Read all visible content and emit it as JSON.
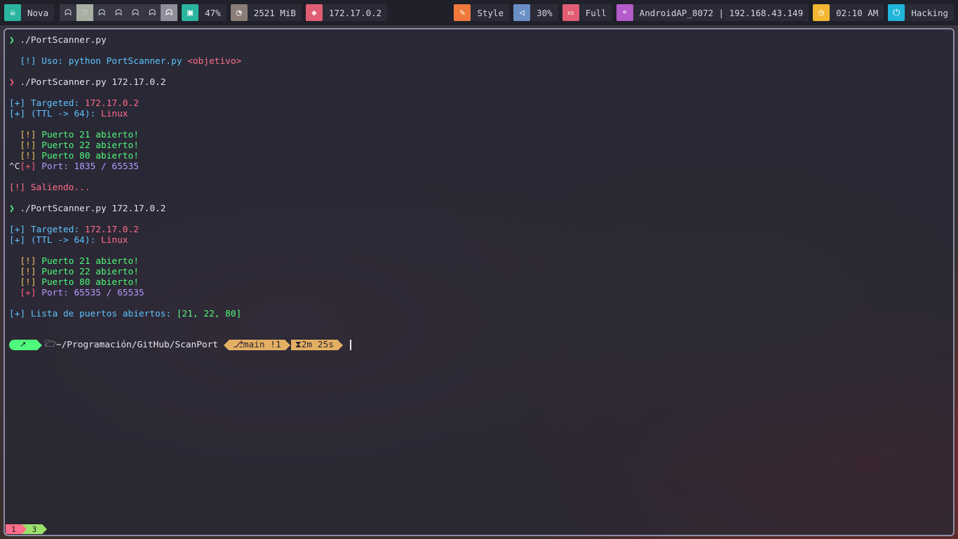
{
  "topbar": {
    "launcher": {
      "icon": "skull-icon",
      "label": "Nova",
      "color": "#2ab5a0"
    },
    "workspaces": [
      "ghost",
      "heart",
      "ghost",
      "ghost",
      "ghost",
      "ghost",
      "ghost"
    ],
    "cpu": {
      "icon": "cpu-icon",
      "value": "47%",
      "color": "#2ab5a0"
    },
    "memory": {
      "icon": "memory-icon",
      "value": "2521 MiB",
      "color": "#8a7d76"
    },
    "ip": {
      "icon": "tag-icon",
      "value": "172.17.0.2",
      "color": "#e05d73"
    },
    "style": {
      "icon": "brush-icon",
      "label": "Style",
      "color": "#ef7a3c"
    },
    "volume": {
      "icon": "speaker-icon",
      "value": "30%",
      "color": "#6a8fc4"
    },
    "battery": {
      "icon": "battery-icon",
      "value": "Full",
      "color": "#e05d73"
    },
    "network": {
      "icon": "wifi-icon",
      "value": "AndroidAP_8072 | 192.168.43.149",
      "color": "#b45cc9"
    },
    "clock": {
      "icon": "clock-icon",
      "value": "02:10 AM",
      "color": "#f2b632"
    },
    "power": {
      "icon": "power-icon",
      "label": "Hacking",
      "color": "#1fb6d9"
    }
  },
  "terminal": {
    "lines": [
      [
        {
          "t": "❯ ",
          "c": "green"
        },
        {
          "t": "./PortScanner.py",
          "c": "white"
        }
      ],
      [],
      [
        {
          "t": "  [!] Uso: ",
          "c": "cyan"
        },
        {
          "t": "python PortScanner.py ",
          "c": "cyan"
        },
        {
          "t": "<objetivo>",
          "c": "pink"
        }
      ],
      [],
      [
        {
          "t": "❯ ",
          "c": "red"
        },
        {
          "t": "./PortScanner.py 172.17.0.2",
          "c": "white"
        }
      ],
      [],
      [
        {
          "t": "[+] Targeted: ",
          "c": "cyan"
        },
        {
          "t": "172.17.0.2",
          "c": "pink"
        }
      ],
      [
        {
          "t": "[+] (TTL -> 64): ",
          "c": "cyan"
        },
        {
          "t": "Linux",
          "c": "pink"
        }
      ],
      [],
      [
        {
          "t": "  [!] ",
          "c": "yellow"
        },
        {
          "t": "Puerto 21 abierto!",
          "c": "green"
        }
      ],
      [
        {
          "t": "  [!] ",
          "c": "yellow"
        },
        {
          "t": "Puerto 22 abierto!",
          "c": "green"
        }
      ],
      [
        {
          "t": "  [!] ",
          "c": "yellow"
        },
        {
          "t": "Puerto 80 abierto!",
          "c": "green"
        }
      ],
      [
        {
          "t": "^C",
          "c": "white"
        },
        {
          "t": "[+] ",
          "c": "red"
        },
        {
          "t": "Port: 1835 / 65535",
          "c": "violet"
        }
      ],
      [],
      [
        {
          "t": "[!] Saliendo...",
          "c": "pink"
        }
      ],
      [],
      [
        {
          "t": "❯ ",
          "c": "green"
        },
        {
          "t": "./PortScanner.py 172.17.0.2",
          "c": "white"
        }
      ],
      [],
      [
        {
          "t": "[+] Targeted: ",
          "c": "cyan"
        },
        {
          "t": "172.17.0.2",
          "c": "pink"
        }
      ],
      [
        {
          "t": "[+] (TTL -> 64): ",
          "c": "cyan"
        },
        {
          "t": "Linux",
          "c": "pink"
        }
      ],
      [],
      [
        {
          "t": "  [!] ",
          "c": "yellow"
        },
        {
          "t": "Puerto 21 abierto!",
          "c": "green"
        }
      ],
      [
        {
          "t": "  [!] ",
          "c": "yellow"
        },
        {
          "t": "Puerto 22 abierto!",
          "c": "green"
        }
      ],
      [
        {
          "t": "  [!] ",
          "c": "yellow"
        },
        {
          "t": "Puerto 80 abierto!",
          "c": "green"
        }
      ],
      [
        {
          "t": "  [+] ",
          "c": "red"
        },
        {
          "t": "Port: 65535 / 65535",
          "c": "violet"
        }
      ],
      [],
      [
        {
          "t": "[+] Lista de puertos abiertos: ",
          "c": "cyan"
        },
        {
          "t": "[21, 22, 80]",
          "c": "green"
        }
      ]
    ],
    "prompt": {
      "os_icon": "arch-icon",
      "path": "~/Programación/GitHub/ScanPort",
      "git": "main !1",
      "duration": "2m 25s"
    }
  },
  "workspace_badges": [
    "1",
    "3"
  ]
}
